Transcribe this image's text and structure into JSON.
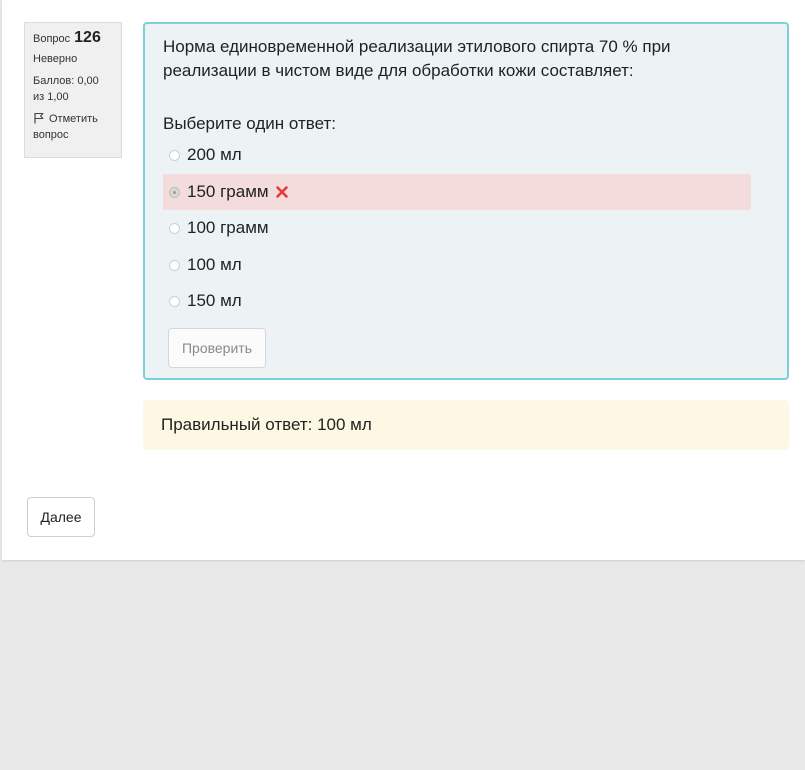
{
  "question_info": {
    "label": "Вопрос",
    "number": "126",
    "state": "Неверно",
    "grade": "Баллов: 0,00 из 1,00",
    "flag_label": "Отметить вопрос"
  },
  "question": {
    "text": "Норма единовременной реализации этилового спирта 70 % при реализации в чистом виде для обработки кожи составляет:",
    "prompt": "Выберите один ответ:",
    "options": [
      {
        "label": "200 мл",
        "selected": false,
        "status": "none"
      },
      {
        "label": "150 грамм",
        "selected": true,
        "status": "incorrect"
      },
      {
        "label": "100 грамм",
        "selected": false,
        "status": "none"
      },
      {
        "label": "100 мл",
        "selected": false,
        "status": "none"
      },
      {
        "label": "150 мл",
        "selected": false,
        "status": "none"
      }
    ],
    "check_button": "Проверить"
  },
  "feedback": {
    "right_answer": "Правильный ответ: 100 мл"
  },
  "navigation": {
    "next_button": "Далее"
  },
  "icons": {
    "flag": "flag-icon",
    "incorrect": "cross-icon"
  },
  "colors": {
    "question_border": "#7fcfdb",
    "question_bg": "#edf3f5",
    "incorrect_bg": "#f5dcdc",
    "incorrect_icon": "#e03c3c",
    "feedback_bg": "#fcf8e3"
  }
}
